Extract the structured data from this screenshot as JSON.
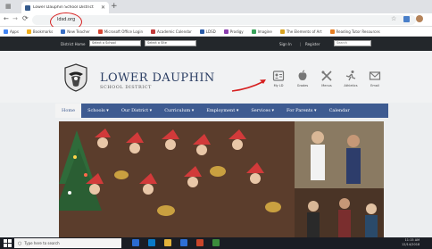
{
  "browser": {
    "tab_title": "Lower Dauphin School District",
    "close_glyph": "✕",
    "new_tab_glyph": "+",
    "url": "ldsd.org",
    "back_glyph": "←",
    "forward_glyph": "→",
    "reload_glyph": "⟳",
    "star_glyph": "☆",
    "bookmarks": [
      {
        "label": "Apps",
        "color": "#4285f4"
      },
      {
        "label": "Bookmarks",
        "color": "#f2b01e"
      },
      {
        "label": "New Teacher",
        "color": "#3a6fc4"
      },
      {
        "label": "Microsoft Office Login",
        "color": "#d64532"
      },
      {
        "label": "Academic Calendar",
        "color": "#c23b3b"
      },
      {
        "label": "LDSD",
        "color": "#2b5ca8"
      },
      {
        "label": "Prodigy",
        "color": "#8c3fb0"
      },
      {
        "label": "Imagine",
        "color": "#3aa35c"
      },
      {
        "label": "The Elements of Art",
        "color": "#d9a321"
      },
      {
        "label": "Reading Tutor Resources",
        "color": "#e67e22"
      }
    ]
  },
  "site": {
    "utility": {
      "district_label": "District Home",
      "select_school": "Select a School",
      "select_site": "Select a Site",
      "sign_in": "Sign In",
      "separator": "|",
      "register": "Register",
      "search_placeholder": "Search"
    },
    "school_name": "LOWER DAUPHIN",
    "school_subtitle": "SCHOOL DISTRICT",
    "quick_links": [
      {
        "label": "My LD",
        "icon": "id-card-icon"
      },
      {
        "label": "Grades",
        "icon": "apple-icon"
      },
      {
        "label": "Menus",
        "icon": "utensils-icon"
      },
      {
        "label": "Athletics",
        "icon": "runner-icon"
      },
      {
        "label": "Email",
        "icon": "envelope-icon"
      }
    ],
    "nav": [
      {
        "label": "Home"
      },
      {
        "label": "Schools ▾"
      },
      {
        "label": "Our District ▾"
      },
      {
        "label": "Curriculum ▾"
      },
      {
        "label": "Employment ▾"
      },
      {
        "label": "Services ▾"
      },
      {
        "label": "For Parents ▾"
      },
      {
        "label": "Calendar"
      }
    ]
  },
  "taskbar": {
    "search_placeholder": "Type here to search",
    "time": "11:15 AM",
    "date": "12/14/2018"
  },
  "colors": {
    "nav_blue": "#3e5b91",
    "annotation_red": "#d62020",
    "title_blue": "#2b3e63"
  }
}
